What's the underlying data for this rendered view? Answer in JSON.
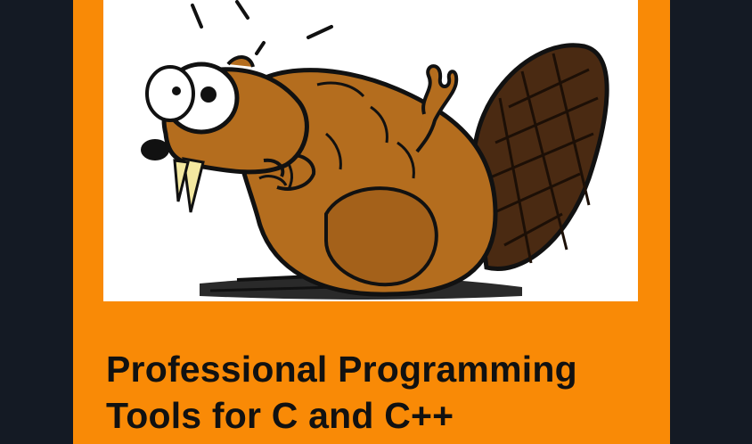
{
  "cover": {
    "title_lines": [
      "Professional Programming",
      "Tools for C and C++"
    ]
  },
  "illustration": {
    "subject": "beaver-icon"
  },
  "colors": {
    "page_background": "#141a24",
    "cover_background": "#f98a06",
    "art_background": "#ffffff",
    "beaver_body": "#b46d1e",
    "beaver_shadow": "#8a4f15",
    "tail": "#4a2a12",
    "teeth": "#f3e8a0",
    "title_text": "#111111"
  }
}
